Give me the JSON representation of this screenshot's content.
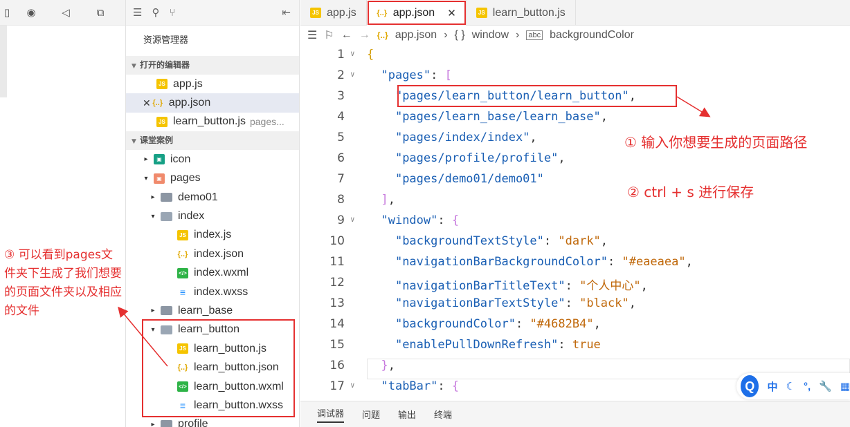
{
  "window_controls": [
    "tablet-icon",
    "record-icon",
    "volume-icon",
    "copy-icon"
  ],
  "explorer": {
    "title": "资源管理器",
    "open_editors_label": "打开的编辑器",
    "open_editors": [
      {
        "name": "app.js",
        "icon": "js"
      },
      {
        "name": "app.json",
        "icon": "json",
        "selected": true
      },
      {
        "name": "learn_button.js",
        "icon": "js",
        "hint": "pages..."
      }
    ],
    "project_label": "课堂案例",
    "tree": [
      {
        "name": "icon",
        "level": 1,
        "arrow": "▸",
        "icon": "icon"
      },
      {
        "name": "pages",
        "level": 1,
        "arrow": "▾",
        "icon": "pages"
      },
      {
        "name": "demo01",
        "level": 2,
        "arrow": "▸",
        "icon": "folder"
      },
      {
        "name": "index",
        "level": 2,
        "arrow": "▾",
        "icon": "folder-open"
      },
      {
        "name": "index.js",
        "level": 3,
        "arrow": "",
        "icon": "js"
      },
      {
        "name": "index.json",
        "level": 3,
        "arrow": "",
        "icon": "json"
      },
      {
        "name": "index.wxml",
        "level": 3,
        "arrow": "",
        "icon": "wxml"
      },
      {
        "name": "index.wxss",
        "level": 3,
        "arrow": "",
        "icon": "wxss"
      },
      {
        "name": "learn_base",
        "level": 2,
        "arrow": "▸",
        "icon": "folder"
      },
      {
        "name": "learn_button",
        "level": 2,
        "arrow": "▾",
        "icon": "folder-open"
      },
      {
        "name": "learn_button.js",
        "level": 3,
        "arrow": "",
        "icon": "js"
      },
      {
        "name": "learn_button.json",
        "level": 3,
        "arrow": "",
        "icon": "json"
      },
      {
        "name": "learn_button.wxml",
        "level": 3,
        "arrow": "",
        "icon": "wxml"
      },
      {
        "name": "learn_button.wxss",
        "level": 3,
        "arrow": "",
        "icon": "wxss"
      },
      {
        "name": "profile",
        "level": 2,
        "arrow": "▸",
        "icon": "folder"
      }
    ]
  },
  "tabs": [
    {
      "label": "app.js",
      "icon": "js"
    },
    {
      "label": "app.json",
      "icon": "json",
      "active": true
    },
    {
      "label": "learn_button.js",
      "icon": "js"
    }
  ],
  "breadcrumb": [
    "app.json",
    "window",
    "backgroundColor"
  ],
  "code_lines": [
    {
      "n": "1",
      "fold": "∨",
      "html": "<span class='br2'>{</span>"
    },
    {
      "n": "2",
      "fold": "∨",
      "html": "  <span class='k'>\"pages\"</span><span class='p'>: </span><span class='br'>[</span>"
    },
    {
      "n": "3",
      "fold": "",
      "html": "    <span class='s'>\"pages/learn_button/learn_button\"</span><span class='p'>,</span>"
    },
    {
      "n": "4",
      "fold": "",
      "html": "    <span class='s'>\"pages/learn_base/learn_base\"</span><span class='p'>,</span>"
    },
    {
      "n": "5",
      "fold": "",
      "html": "    <span class='s'>\"pages/index/index\"</span><span class='p'>,</span>"
    },
    {
      "n": "6",
      "fold": "",
      "html": "    <span class='s'>\"pages/profile/profile\"</span><span class='p'>,</span>"
    },
    {
      "n": "7",
      "fold": "",
      "html": "    <span class='s'>\"pages/demo01/demo01\"</span>"
    },
    {
      "n": "8",
      "fold": "",
      "html": "  <span class='br'>]</span><span class='p'>,</span>"
    },
    {
      "n": "9",
      "fold": "∨",
      "html": "  <span class='k'>\"window\"</span><span class='p'>: </span><span class='br'>{</span>"
    },
    {
      "n": "10",
      "fold": "",
      "html": "    <span class='k'>\"backgroundTextStyle\"</span><span class='p'>: </span><span class='v'>\"dark\"</span><span class='p'>,</span>"
    },
    {
      "n": "11",
      "fold": "",
      "html": "    <span class='k'>\"navigationBarBackgroundColor\"</span><span class='p'>: </span><span class='v'>\"#eaeaea\"</span><span class='p'>,</span>"
    },
    {
      "n": "12",
      "fold": "",
      "html": "    <span class='k'>\"navigationBarTitleText\"</span><span class='p'>: </span><span class='v'>\"个人中心\"</span><span class='p'>,</span>"
    },
    {
      "n": "13",
      "fold": "",
      "html": "    <span class='k'>\"navigationBarTextStyle\"</span><span class='p'>: </span><span class='v'>\"black\"</span><span class='p'>,</span>"
    },
    {
      "n": "14",
      "fold": "",
      "html": "    <span class='k'>\"backgroundColor\"</span><span class='p'>: </span><span class='v'>\"#4682B4\"</span><span class='p'>,</span>"
    },
    {
      "n": "15",
      "fold": "",
      "html": "    <span class='k'>\"enablePullDownRefresh\"</span><span class='p'>: </span><span class='v'>true</span>"
    },
    {
      "n": "16",
      "fold": "",
      "html": "  <span class='br'>}</span><span class='p'>,</span>"
    },
    {
      "n": "17",
      "fold": "∨",
      "html": "  <span class='k'>\"tabBar\"</span><span class='p'>: </span><span class='br'>{</span>"
    }
  ],
  "annotations": {
    "step1": "① 输入你想要生成的页面路径",
    "step2": "② ctrl + s 进行保存",
    "step3": "③ 可以看到pages文件夹下生成了我们想要的页面文件夹以及相应的文件"
  },
  "bottom_tabs": [
    "调试器",
    "问题",
    "输出",
    "终端"
  ],
  "ime": {
    "logo": "Q",
    "lang": "中",
    "items": [
      "moon-icon",
      "punctuation-icon",
      "wrench-icon",
      "grid-icon"
    ]
  },
  "colors": {
    "highlight": "#e53030",
    "ime_blue": "#1e6fe8"
  }
}
